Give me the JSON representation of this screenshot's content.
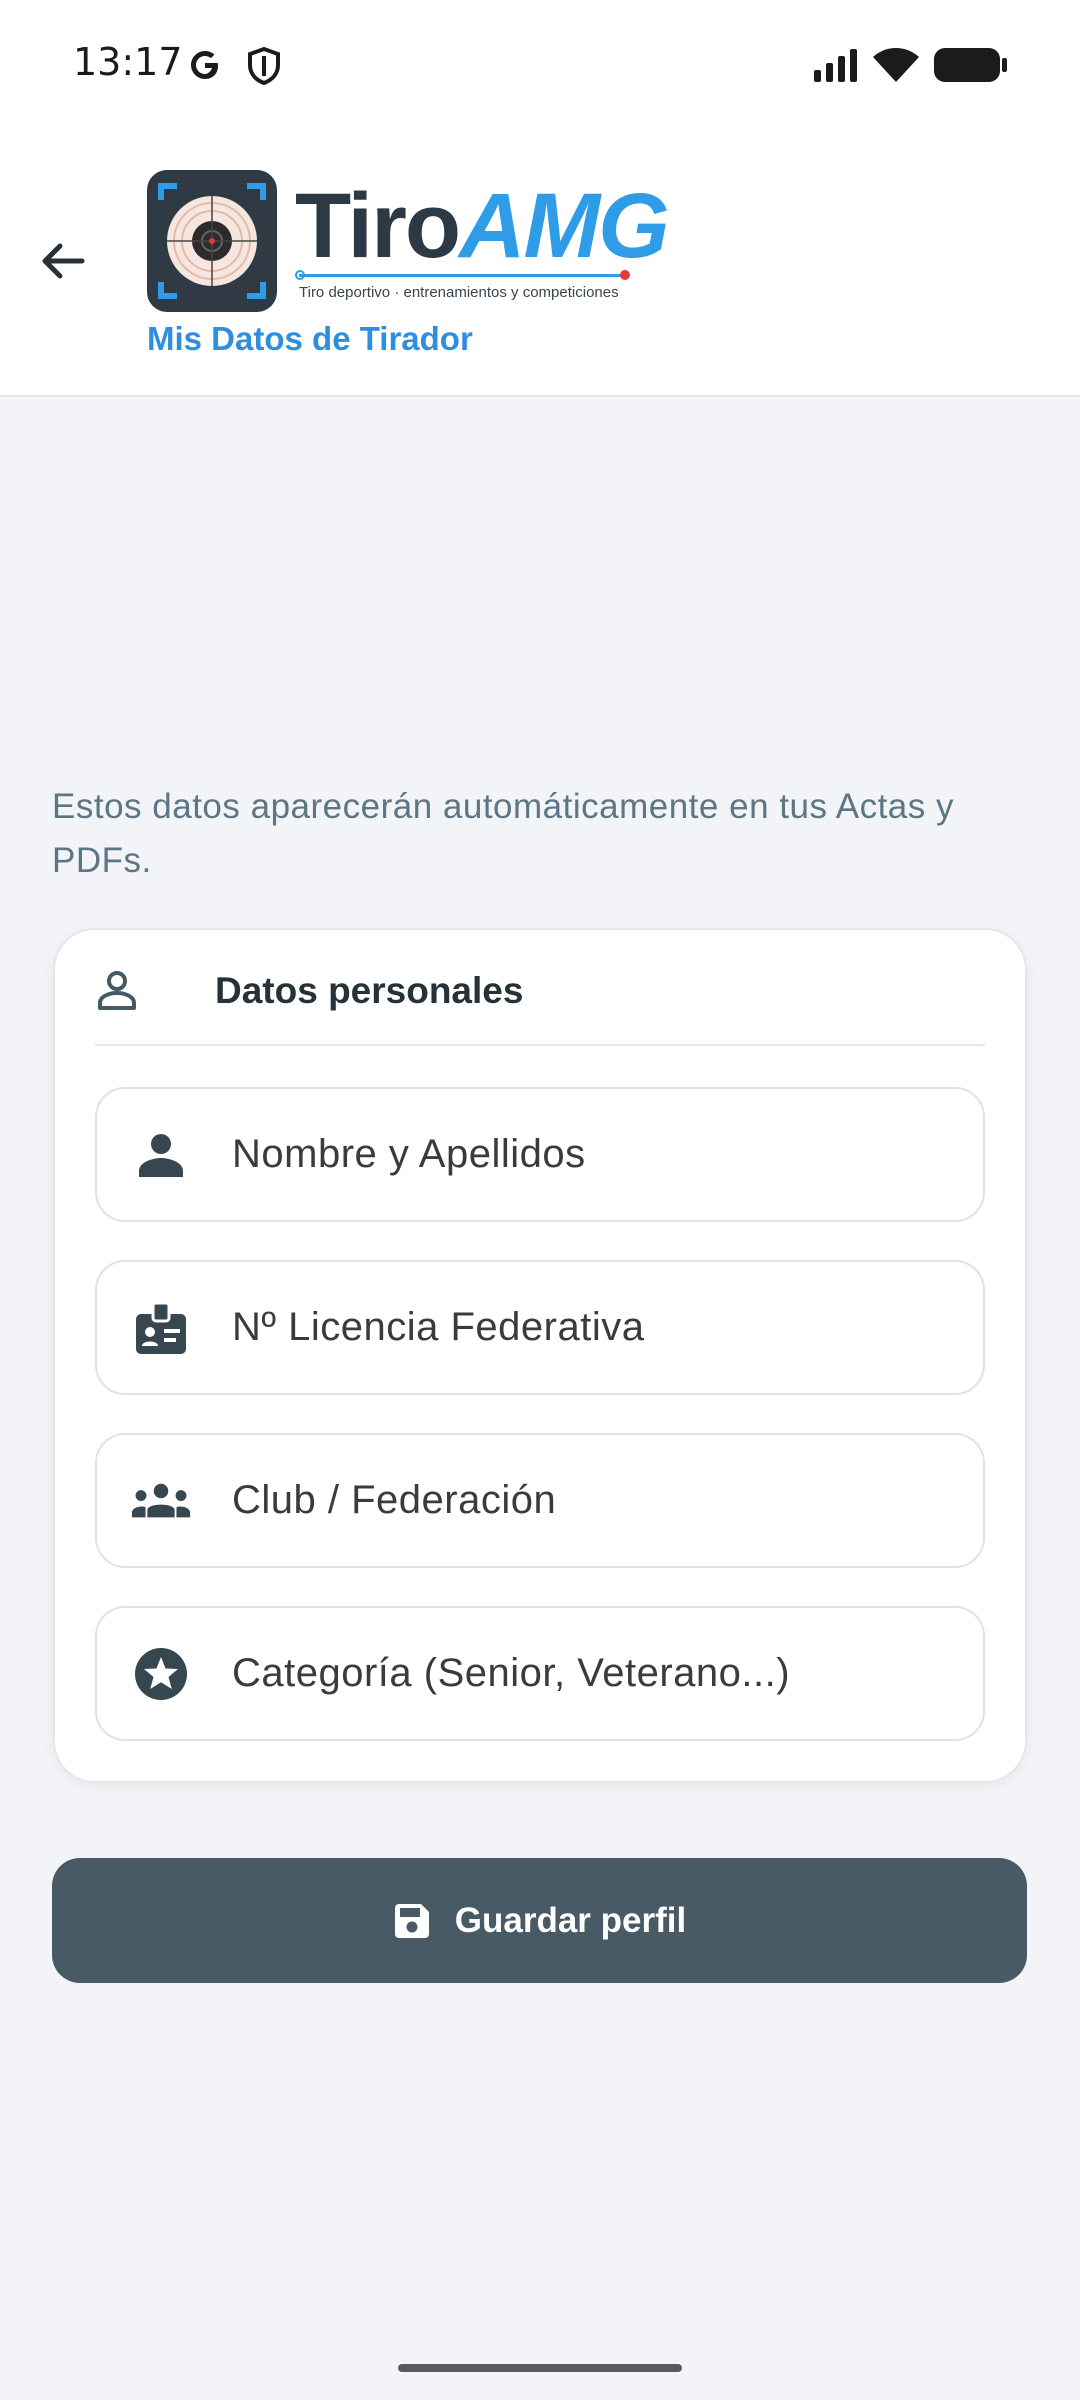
{
  "status_bar": {
    "time": "13:17",
    "icons": [
      "google-icon",
      "shield-icon",
      "signal-icon",
      "wifi-icon",
      "battery-icon"
    ]
  },
  "app_bar": {
    "back_icon": "arrow-left-icon",
    "logo": {
      "name_part1": "Tiro",
      "name_part2": "AMG",
      "tagline": "Tiro deportivo · entrenamientos y competiciones"
    },
    "subtitle": "Mis Datos de Tirador"
  },
  "intro_text": "Estos datos aparecerán automáticamente en tus Actas y PDFs.",
  "card": {
    "title": "Datos personales",
    "icon": "person-outline-icon",
    "fields": [
      {
        "icon": "person-icon",
        "placeholder": "Nombre y Apellidos",
        "value": ""
      },
      {
        "icon": "badge-icon",
        "placeholder": "Nº Licencia Federativa",
        "value": ""
      },
      {
        "icon": "groups-icon",
        "placeholder": "Club / Federación",
        "value": ""
      },
      {
        "icon": "star-circle-icon",
        "placeholder": "Categoría (Senior, Veterano...)",
        "value": ""
      }
    ]
  },
  "save_button": {
    "label": "Guardar perfil",
    "icon": "save-icon"
  },
  "colors": {
    "accent": "#2e8ee0",
    "button": "#485a65",
    "background": "#f2f4f7",
    "muted_text": "#5d7686"
  }
}
